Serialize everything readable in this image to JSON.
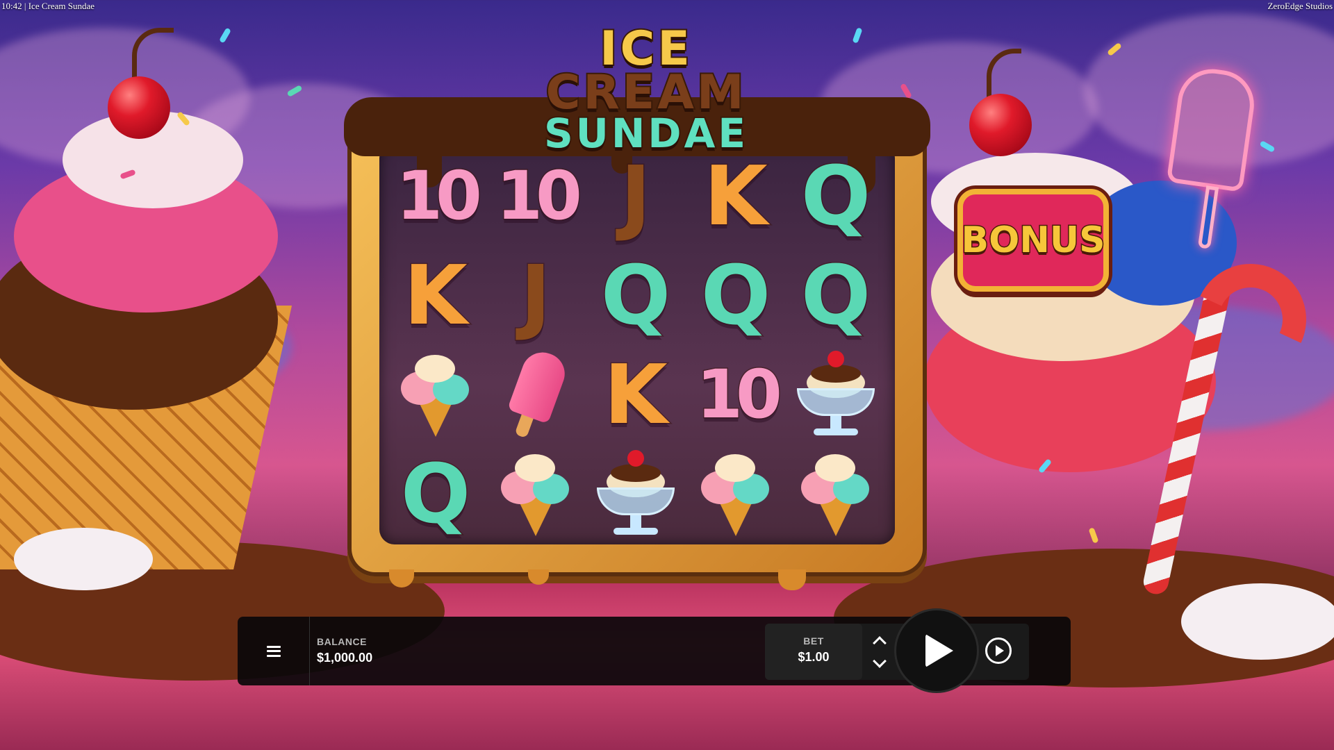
{
  "header": {
    "left_text": "10:42 | Ice Cream Sundae",
    "right_text": "ZeroEdge Studios"
  },
  "logo": {
    "line1": "ICE",
    "line2": "CREAM",
    "line3": "SUNDAE"
  },
  "bonus": {
    "label": "BONUS"
  },
  "reels": {
    "rows": [
      [
        {
          "type": "letter",
          "text": "10",
          "variant": "ten"
        },
        {
          "type": "letter",
          "text": "10",
          "variant": "ten"
        },
        {
          "type": "letter",
          "text": "J",
          "variant": "j"
        },
        {
          "type": "letter",
          "text": "K",
          "variant": "k"
        },
        {
          "type": "letter",
          "text": "Q",
          "variant": "q"
        }
      ],
      [
        {
          "type": "letter",
          "text": "K",
          "variant": "k"
        },
        {
          "type": "letter",
          "text": "J",
          "variant": "j"
        },
        {
          "type": "letter",
          "text": "Q",
          "variant": "q"
        },
        {
          "type": "letter",
          "text": "Q",
          "variant": "q"
        },
        {
          "type": "letter",
          "text": "Q",
          "variant": "q"
        }
      ],
      [
        {
          "type": "icon",
          "icon": "ice-cream-cone-icon"
        },
        {
          "type": "icon",
          "icon": "popsicle-icon"
        },
        {
          "type": "letter",
          "text": "K",
          "variant": "k"
        },
        {
          "type": "letter",
          "text": "10",
          "variant": "ten"
        },
        {
          "type": "icon",
          "icon": "sundae-icon"
        }
      ],
      [
        {
          "type": "letter",
          "text": "Q",
          "variant": "q"
        },
        {
          "type": "icon",
          "icon": "ice-cream-cone-icon"
        },
        {
          "type": "icon",
          "icon": "sundae-icon"
        },
        {
          "type": "icon",
          "icon": "ice-cream-cone-icon"
        },
        {
          "type": "icon",
          "icon": "ice-cream-cone-icon"
        }
      ]
    ]
  },
  "controls": {
    "menu_icon": "hamburger-menu-icon",
    "balance_label": "BALANCE",
    "balance_value": "$1,000.00",
    "bet_label": "BET",
    "bet_value": "$1.00",
    "bet_increase_icon": "chevron-up-icon",
    "bet_decrease_icon": "chevron-down-icon",
    "spin_icon": "play-icon",
    "autoplay_icon": "autoplay-icon"
  },
  "colors": {
    "ten": "#f79ac4",
    "j": "#8a4a1c",
    "k": "#f6a03a",
    "q": "#5ad8b4",
    "bonus_bg": "#e0285a",
    "bar_bg": "#0a080a"
  }
}
